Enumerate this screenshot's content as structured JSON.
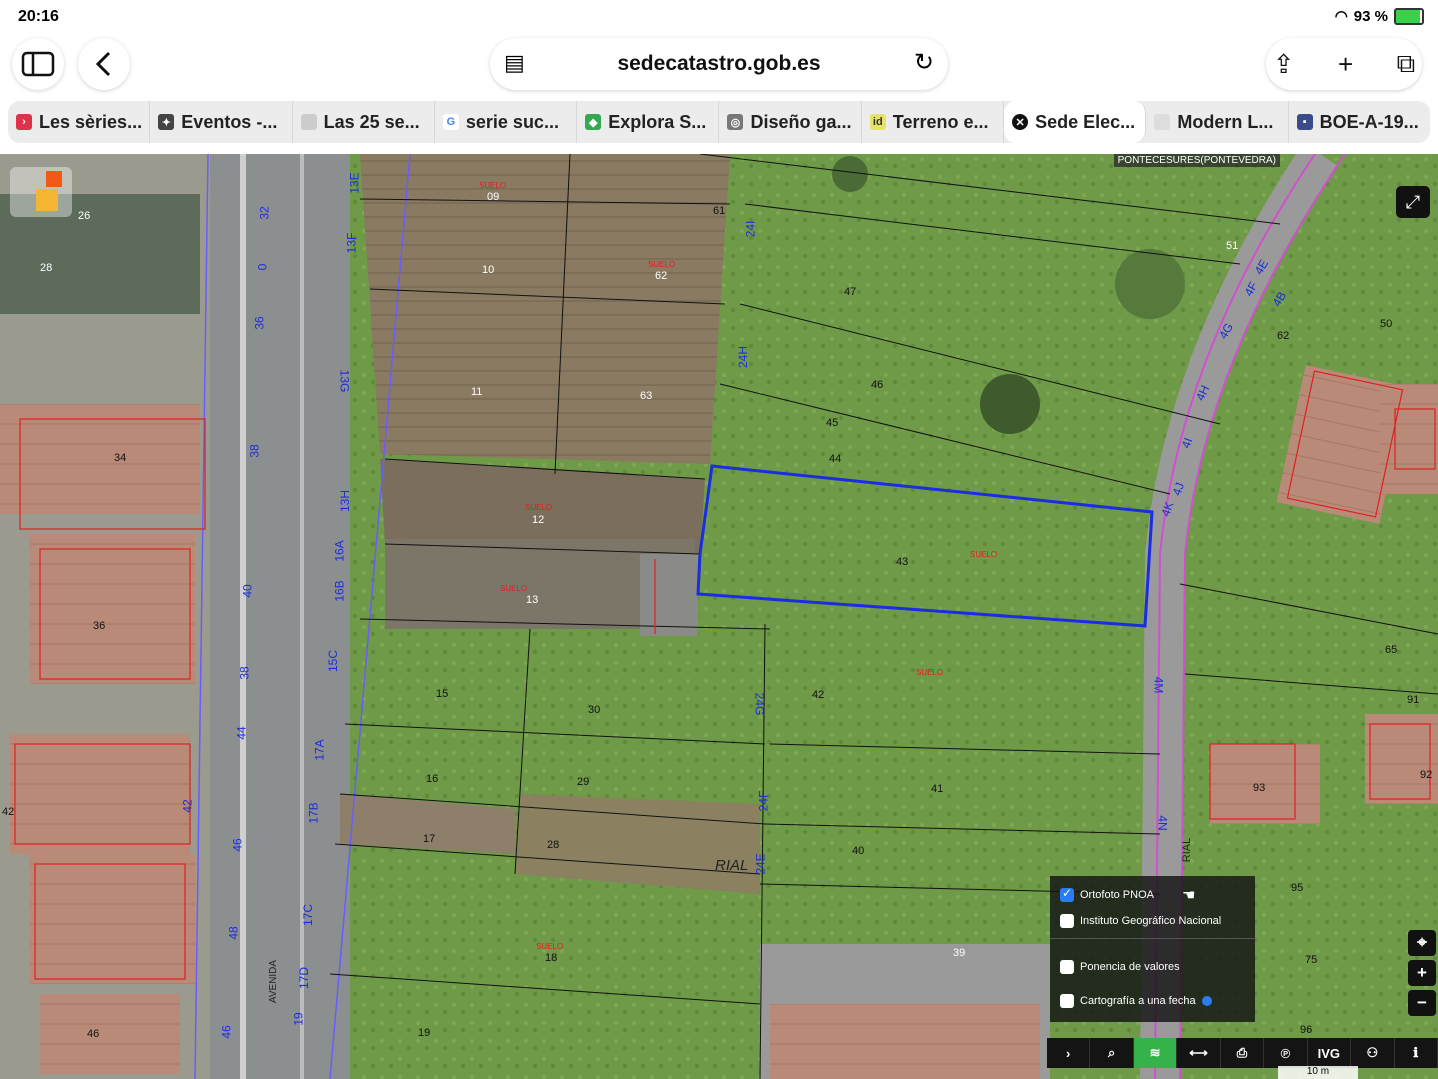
{
  "status": {
    "time": "20:16",
    "battery": "93 %"
  },
  "browser": {
    "url": "sedecatastro.gob.es"
  },
  "tabs": [
    {
      "label": "Les sèries...",
      "icon": "bookmark-icon"
    },
    {
      "label": "Eventos -...",
      "icon": "ai-icon"
    },
    {
      "label": "Las 25 se...",
      "icon": "page-icon"
    },
    {
      "label": "serie suc...",
      "icon": "google-icon"
    },
    {
      "label": "Explora S...",
      "icon": "maps-icon"
    },
    {
      "label": "Diseño ga...",
      "icon": "globe-icon"
    },
    {
      "label": "Terreno e...",
      "icon": "id-icon"
    },
    {
      "label": "Sede Elec...",
      "icon": "close-icon",
      "active": true
    },
    {
      "label": "Modern L...",
      "icon": "page-icon"
    },
    {
      "label": "BOE-A-19...",
      "icon": "boe-icon"
    }
  ],
  "map": {
    "region_label": "PONTECESURES(PONTEVEDRA)",
    "parcels": [
      "09",
      "10",
      "11",
      "12",
      "13",
      "15",
      "16",
      "17",
      "18",
      "19",
      "30",
      "29",
      "28",
      "61",
      "62",
      "63",
      "47",
      "46",
      "45",
      "44",
      "43",
      "42",
      "41",
      "40",
      "39",
      "51",
      "50",
      "62",
      "93",
      "95",
      "96",
      "75",
      "65",
      "91",
      "92",
      "34",
      "36",
      "42",
      "46",
      "26",
      "28"
    ],
    "parcel_label": "SUELO",
    "street_label": "RIAL",
    "avenue_label": "AVENIDA",
    "road_numbers": [
      "32",
      "0",
      "36",
      "38",
      "40",
      "38",
      "44",
      "42",
      "46",
      "48",
      "46"
    ],
    "road_codes": [
      "13E",
      "13F",
      "13G",
      "13H",
      "16A",
      "16B",
      "15C",
      "17A",
      "17B",
      "17C",
      "17D",
      "19",
      "24I",
      "24H",
      "24G",
      "24F",
      "24E",
      "4M",
      "4N",
      "4K",
      "4J",
      "4I",
      "4H",
      "4G",
      "4F",
      "4E",
      "4B"
    ]
  },
  "layers": {
    "items": [
      {
        "label": "Ortofoto PNOA",
        "checked": true
      },
      {
        "label": "Instituto Geográfico Nacional",
        "checked": false
      },
      {
        "label": "Ponencia de valores",
        "checked": false
      },
      {
        "label": "Cartografía a una fecha",
        "checked": false
      }
    ]
  },
  "toolbar": {
    "tools": [
      "›",
      "⌕",
      "≋",
      "⟷",
      "⎙",
      "℗",
      "IVG",
      "⚇",
      "ℹ"
    ]
  },
  "scale": "10 m"
}
